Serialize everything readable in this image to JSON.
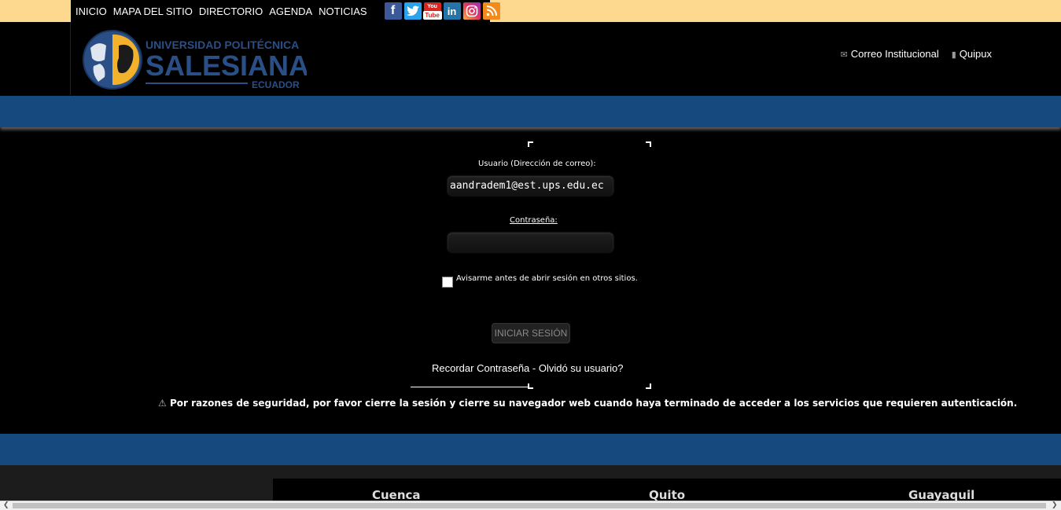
{
  "topnav": {
    "items": [
      "INICIO",
      "MAPA DEL SITIO",
      "DIRECTORIO",
      "AGENDA",
      "NOTICIAS"
    ],
    "social": [
      "facebook",
      "twitter",
      "youtube",
      "linkedin",
      "instagram",
      "rss"
    ]
  },
  "logo": {
    "line1": "UNIVERSIDAD POLITÉCNICA",
    "line2": "SALESIANA",
    "line3": "ECUADOR"
  },
  "header_links": {
    "mail": "Correo Institucional",
    "quipux": "Quipux"
  },
  "login": {
    "user_label": "Usuario (Dirección de correo):",
    "user_value": "aandradem1@est.ups.edu.ec",
    "password_label": "Contraseña:",
    "password_value": "",
    "remember_label": "Avisarme antes de abrir sesión en otros sitios.",
    "submit_label": "INICIAR SESIÓN",
    "recover_text": "Recordar Contraseña  -  Olvidó su usuario?"
  },
  "warning": "Por razones de seguridad, por favor cierre la sesión y cierre su navegador web cuando haya terminado de acceder a los servicios que requieren autenticación.",
  "footer": {
    "cities": [
      "Cuenca",
      "Quito",
      "Guayaquil"
    ]
  },
  "colors": {
    "accent_band": "#164a7f",
    "top_strip": "#fcd98f"
  }
}
